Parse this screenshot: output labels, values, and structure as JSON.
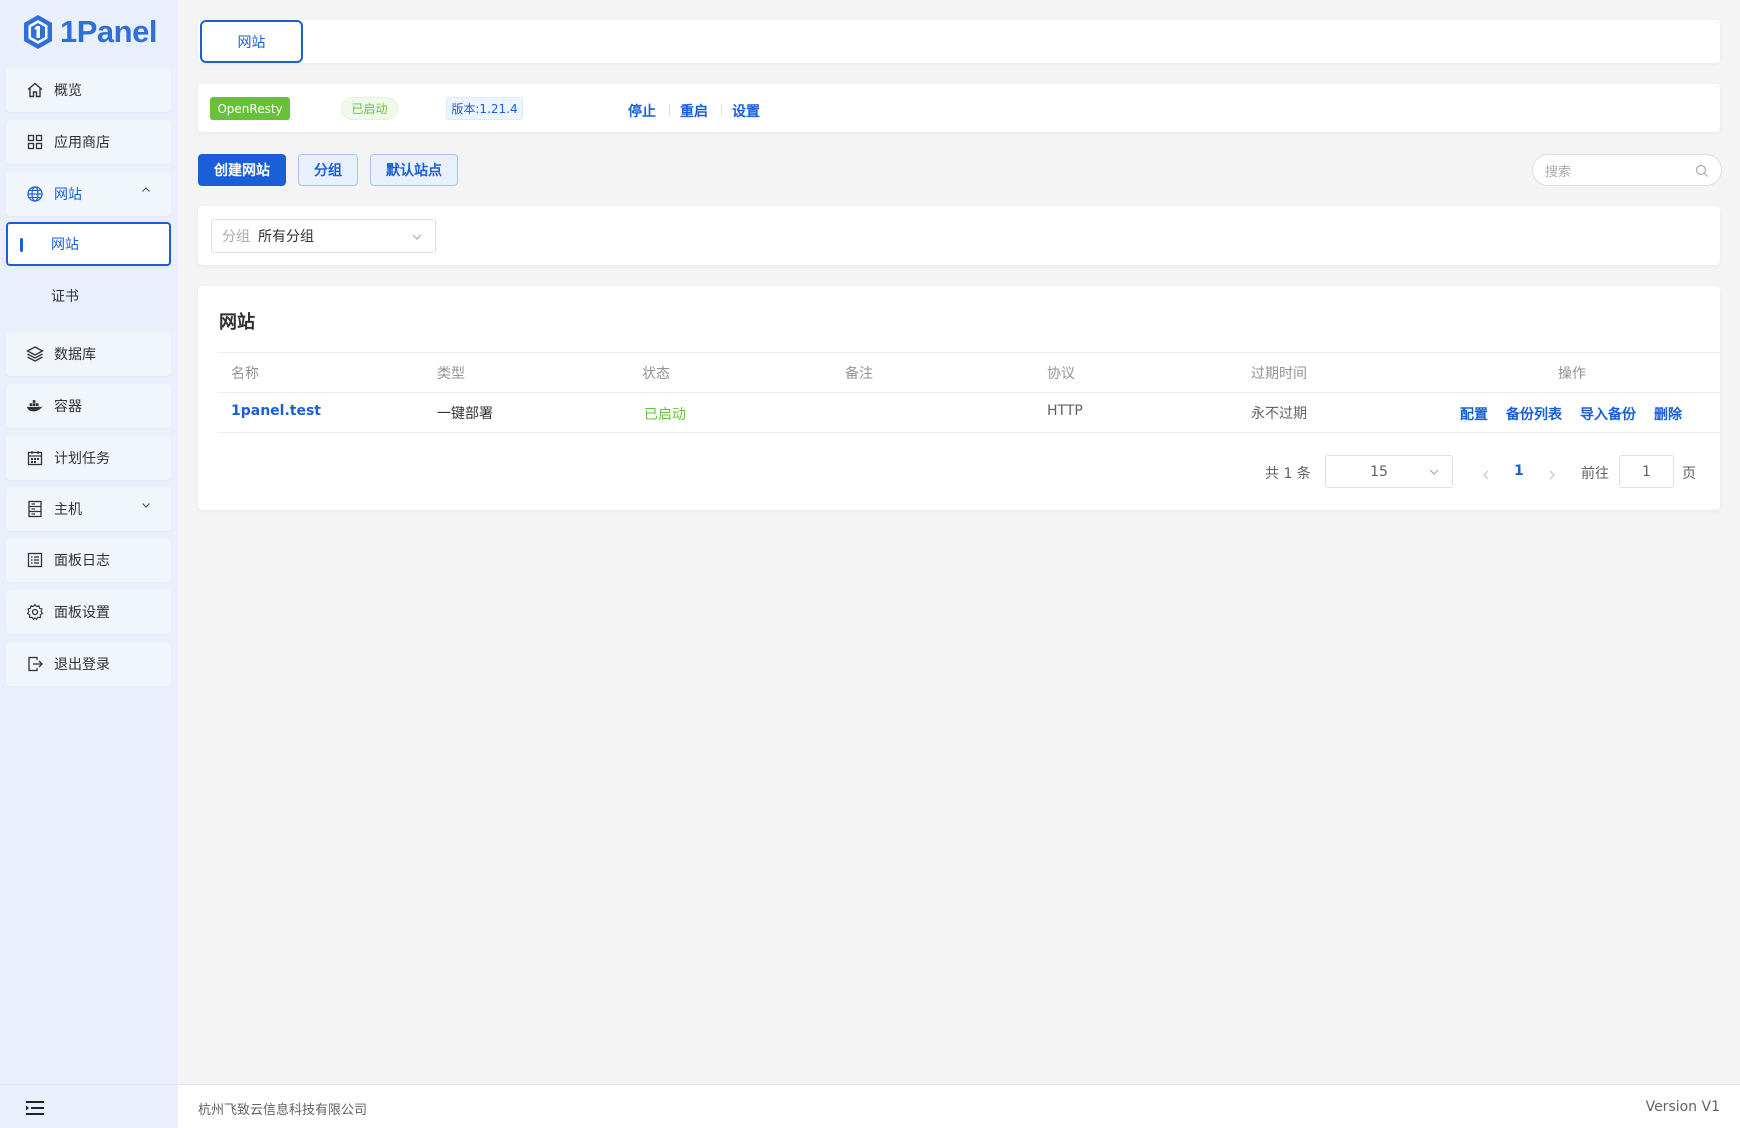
{
  "app": {
    "logo_text": "1Panel",
    "brand_color": "#1a5ed8"
  },
  "sidebar": {
    "items": [
      {
        "label": "概览",
        "icon": "home-icon"
      },
      {
        "label": "应用商店",
        "icon": "grid-icon"
      },
      {
        "label": "网站",
        "icon": "globe-icon"
      },
      {
        "label": "网站"
      },
      {
        "label": "证书"
      },
      {
        "label": "数据库",
        "icon": "layers-icon"
      },
      {
        "label": "容器",
        "icon": "docker-icon"
      },
      {
        "label": "计划任务",
        "icon": "calendar-icon"
      },
      {
        "label": "主机",
        "icon": "server-icon"
      },
      {
        "label": "面板日志",
        "icon": "log-icon"
      },
      {
        "label": "面板设置",
        "icon": "gear-icon"
      },
      {
        "label": "退出登录",
        "icon": "logout-icon"
      }
    ]
  },
  "tabs": {
    "active_label": "网站"
  },
  "server_bar": {
    "app_name": "OpenResty",
    "status": "已启动",
    "version": "版本:1.21.4",
    "actions": [
      "停止",
      "重启",
      "设置"
    ]
  },
  "toolbar": {
    "create_label": "创建网站",
    "group_label": "分组",
    "default_site_label": "默认站点",
    "search_placeholder": "搜索"
  },
  "filter": {
    "prefix": "分组",
    "value": "所有分组"
  },
  "table": {
    "title": "网站",
    "headers": [
      "名称",
      "类型",
      "状态",
      "备注",
      "协议",
      "过期时间",
      "操作"
    ],
    "rows": [
      {
        "name": "1panel.test",
        "type": "一键部署",
        "status": "已启动",
        "remark": "",
        "protocol": "HTTP",
        "expire": "永不过期",
        "actions": [
          "配置",
          "备份列表",
          "导入备份",
          "删除"
        ]
      }
    ]
  },
  "pagination": {
    "total_text": "共 1 条",
    "page_size": "15",
    "current_page": "1",
    "goto_label": "前往",
    "goto_value": "1",
    "page_suffix": "页"
  },
  "footer": {
    "company": "杭州飞致云信息科技有限公司",
    "version": "Version V1"
  }
}
